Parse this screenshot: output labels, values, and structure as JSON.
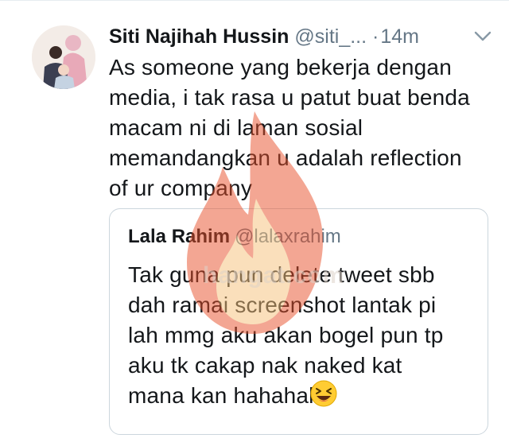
{
  "tweet": {
    "display_name": "Siti Najihah Hussin",
    "handle": "@siti_...",
    "dot": "·",
    "time": "14m",
    "text": "As someone yang bekerja dengan\nmedia, i tak rasa u patut buat benda\nmacam ni di laman sosial\nmemandangkan u adalah reflection\nof ur company"
  },
  "quoted_tweet": {
    "display_name": "Lala Rahim",
    "handle": "@lalaxrahim",
    "text": "Tak guna pun delete tweet sbb\ndah ramai screenshot lantak pi\nlah mmg aku akan bogel pun tp\naku tk cakap nak naked kat\nmana kan hahahah"
  },
  "watermark": {
    "text": "hangat.com"
  },
  "icons": {
    "avatar": "profile-photo",
    "menu": "chevron-down-icon",
    "emoji": "laughing-squinting-face",
    "watermark_logo": "flame-logo"
  },
  "colors": {
    "text_primary": "#14171a",
    "text_secondary": "#657786",
    "border": "#ccd6dd",
    "watermark_flame": "#e8502a"
  }
}
